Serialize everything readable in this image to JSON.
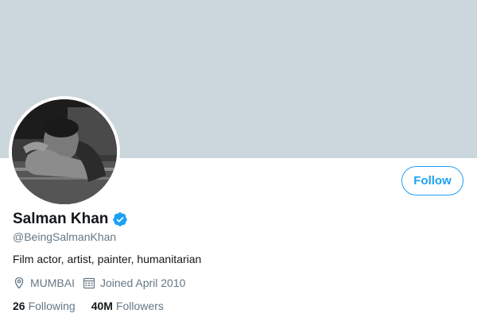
{
  "profile": {
    "name": "Salman Khan",
    "handle": "@BeingSalmanKhan",
    "bio": "Film actor, artist, painter, humanitarian",
    "location": "MUMBAI",
    "joined": "Joined April 2010",
    "verified": true
  },
  "actions": {
    "follow_label": "Follow"
  },
  "stats": {
    "following_count": "26",
    "following_label": "Following",
    "followers_count": "40M",
    "followers_label": "Followers"
  },
  "icons": {
    "verified": "verified-badge-icon",
    "location": "location-pin-icon",
    "calendar": "calendar-icon"
  },
  "colors": {
    "accent": "#1da1f2",
    "banner": "#ccd6dd",
    "secondary_text": "#657786",
    "primary_text": "#14171a"
  }
}
